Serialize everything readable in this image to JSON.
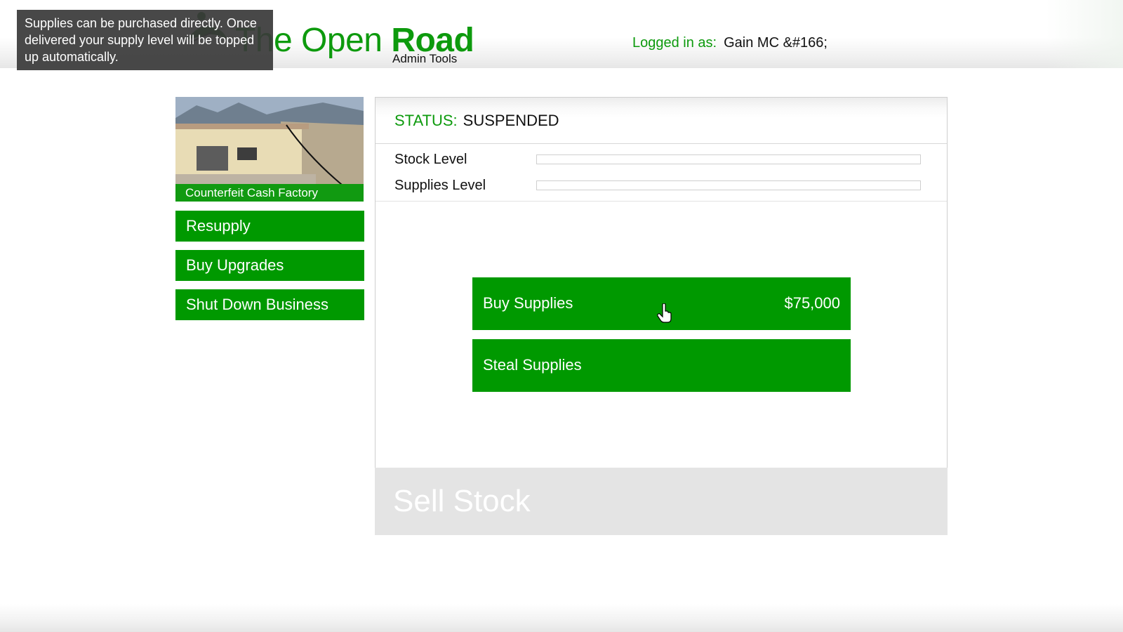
{
  "header": {
    "logo_title_regular": "The Open ",
    "logo_title_bold": "Road",
    "logo_subtitle": "Admin Tools",
    "login_label": "Logged in as:",
    "login_user": "Gain MC &#166;"
  },
  "tooltip": {
    "text": "Supplies can be purchased directly. Once delivered your supply level will be topped up automatically."
  },
  "business": {
    "name": "Counterfeit Cash Factory"
  },
  "sidebar": {
    "items": [
      {
        "label": "Resupply"
      },
      {
        "label": "Buy Upgrades"
      },
      {
        "label": "Shut Down Business"
      }
    ]
  },
  "panel": {
    "status_label": "STATUS:",
    "status_value": "SUSPENDED",
    "levels": [
      {
        "label": "Stock Level",
        "fill_percent": 0
      },
      {
        "label": "Supplies Level",
        "fill_percent": 0
      }
    ],
    "actions": [
      {
        "label": "Buy Supplies",
        "price": "$75,000"
      },
      {
        "label": "Steal Supplies",
        "price": ""
      }
    ],
    "sell_label": "Sell Stock"
  },
  "colors": {
    "brand_green": "#0d9a0d",
    "button_green": "#009900",
    "disabled_gray": "#e4e4e4",
    "tooltip_bg": "#3a3a3a"
  }
}
